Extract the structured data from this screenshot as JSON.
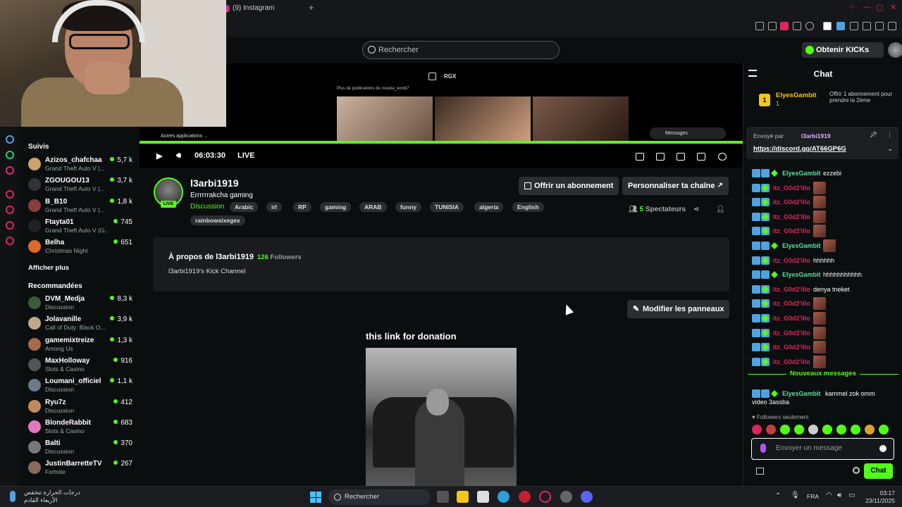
{
  "browser": {
    "tab_label": "(9) Instagram",
    "new_tab_symbol": "+"
  },
  "header": {
    "search_placeholder": "Rechercher",
    "get_kicks_label": "Obtenir KICKs"
  },
  "sidebar": {
    "following_title": "Suivis",
    "following": [
      {
        "name": "Azizos_chafchaa",
        "category": "Grand Theft Auto V (...",
        "viewers": "5,7 k",
        "color": "#c9a46a"
      },
      {
        "name": "ZGOUGOU13",
        "category": "Grand Theft Auto V (...",
        "viewers": "3,7 k",
        "color": "#333333"
      },
      {
        "name": "B_B10",
        "category": "Grand Theft Auto V (...",
        "viewers": "1,8 k",
        "color": "#8a3c3c"
      },
      {
        "name": "Ftayta01",
        "category": "Grand Theft Auto V (G...",
        "viewers": "745",
        "color": "#222222"
      },
      {
        "name": "Belha",
        "category": "Christmas Night",
        "viewers": "651",
        "color": "#d86a2a"
      }
    ],
    "show_more": "Afficher plus",
    "recommended_title": "Recommandées",
    "recommended": [
      {
        "name": "DVM_Medja",
        "category": "Discussion",
        "viewers": "8,3 k",
        "color": "#3c5a3c"
      },
      {
        "name": "Jolavanille",
        "category": "Call of Duty: Black O...",
        "viewers": "3,9 k",
        "color": "#bfa98a"
      },
      {
        "name": "gamemixtreize",
        "category": "Among Us",
        "viewers": "1,3 k",
        "color": "#a86a4a"
      },
      {
        "name": "MaxHolloway",
        "category": "Slots & Casino",
        "viewers": "916",
        "color": "#555555"
      },
      {
        "name": "Loumani_officiel",
        "category": "Discussion",
        "viewers": "1,1 k",
        "color": "#6a7a8a"
      },
      {
        "name": "Ryu7z",
        "category": "Discussion",
        "viewers": "412",
        "color": "#c08a5a"
      },
      {
        "name": "BlondeRabbit",
        "category": "Slots & Casino",
        "viewers": "683",
        "color": "#e07ac0"
      },
      {
        "name": "Balti",
        "category": "Discussion",
        "viewers": "370",
        "color": "#777777"
      },
      {
        "name": "JustinBarretteTV",
        "category": "Fortnite",
        "viewers": "267",
        "color": "#8a6a5a"
      }
    ]
  },
  "player": {
    "time": "06:03:30",
    "live_label": "LIVE",
    "rgx": "RGX",
    "ig_caption": "Plus de publications de rouuka_world7",
    "messages_chip": "Messages",
    "autres": "Autres applications ..."
  },
  "channel": {
    "name": "l3arbi1919",
    "title": "Errrrrrakcha gaming",
    "category": "Discussion",
    "tags": [
      "Arabic",
      "irl",
      "RP",
      "gaming",
      "ARAB",
      "funny",
      "TUNISIA",
      "algeria",
      "English",
      "rainbowsixegex"
    ],
    "subscribe_label": "Offrir un abonnement",
    "customize_label": "Personnaliser ta chaîne",
    "viewers_count": "5",
    "viewers_label": "Spectateurs",
    "live_badge": "LIVE",
    "about_title": "À propos de l3arbi1919",
    "followers_count": "126",
    "followers_label": "Followers",
    "about_desc": "l3arbi1919's Kick Channel",
    "edit_panels_label": "Modifier les panneaux",
    "donation_title": "this link for donation"
  },
  "chat": {
    "title": "Chat",
    "gift_user": "ElyesGambit",
    "gift_count": "1",
    "gift_text": "Offrir 1 abonnement pour prendre la 2ème",
    "pinned_by_label": "Envoyé par",
    "pinned_user": "l3arbi1919",
    "pinned_link": "https://discord.gg/AT66GP6G",
    "messages": [
      {
        "user": "ElyesGambit",
        "text": "ezzebi",
        "color": "#53e0a0",
        "emote": false
      },
      {
        "user": "itz_G0d2'illo",
        "text": "",
        "color": "#e0245e",
        "emote": true
      },
      {
        "user": "itz_G0d2'illo",
        "text": "",
        "color": "#e0245e",
        "emote": true
      },
      {
        "user": "itz_G0d2'illo",
        "text": "",
        "color": "#e0245e",
        "emote": true
      },
      {
        "user": "itz_G0d2'illo",
        "text": "",
        "color": "#e0245e",
        "emote": true
      },
      {
        "user": "ElyesGambit",
        "text": "",
        "color": "#53e0a0",
        "emote": true
      },
      {
        "user": "itz_G0d2'illo",
        "text": "hhhhhh",
        "color": "#e0245e",
        "emote": false
      },
      {
        "user": "ElyesGambit",
        "text": "hhhhhhhhhhh",
        "color": "#53e0a0",
        "emote": false
      },
      {
        "user": "itz_G0d2'illo",
        "text": "denya tneket",
        "color": "#e0245e",
        "emote": false
      },
      {
        "user": "itz_G0d2'illo",
        "text": "",
        "color": "#e0245e",
        "emote": true
      },
      {
        "user": "itz_G0d2'illo",
        "text": "",
        "color": "#e0245e",
        "emote": true
      },
      {
        "user": "itz_G0d2'illo",
        "text": "",
        "color": "#e0245e",
        "emote": true
      },
      {
        "user": "itz_G0d2'illo",
        "text": "",
        "color": "#e0245e",
        "emote": true
      },
      {
        "user": "itz_G0d2'illo",
        "text": "",
        "color": "#e0245e",
        "emote": true
      }
    ],
    "new_messages_label": "Nouveaux messages",
    "last_message": {
      "user": "ElyesGambit",
      "text": "kammel zok omm",
      "text2": "video 3assba"
    },
    "followers_only": "Followers seulement",
    "input_placeholder": "Envoyer un message",
    "send_label": "Chat"
  },
  "taskbar": {
    "weather_line1": "درجات الحرارة تنخفض",
    "weather_line2": "الأربعاء القادم",
    "search_label": "Rechercher",
    "lang": "FRA",
    "time": "03:17",
    "date": "23/11/2025"
  },
  "colors": {
    "kick_green": "#53fc18",
    "background": "#0b0e0f"
  }
}
